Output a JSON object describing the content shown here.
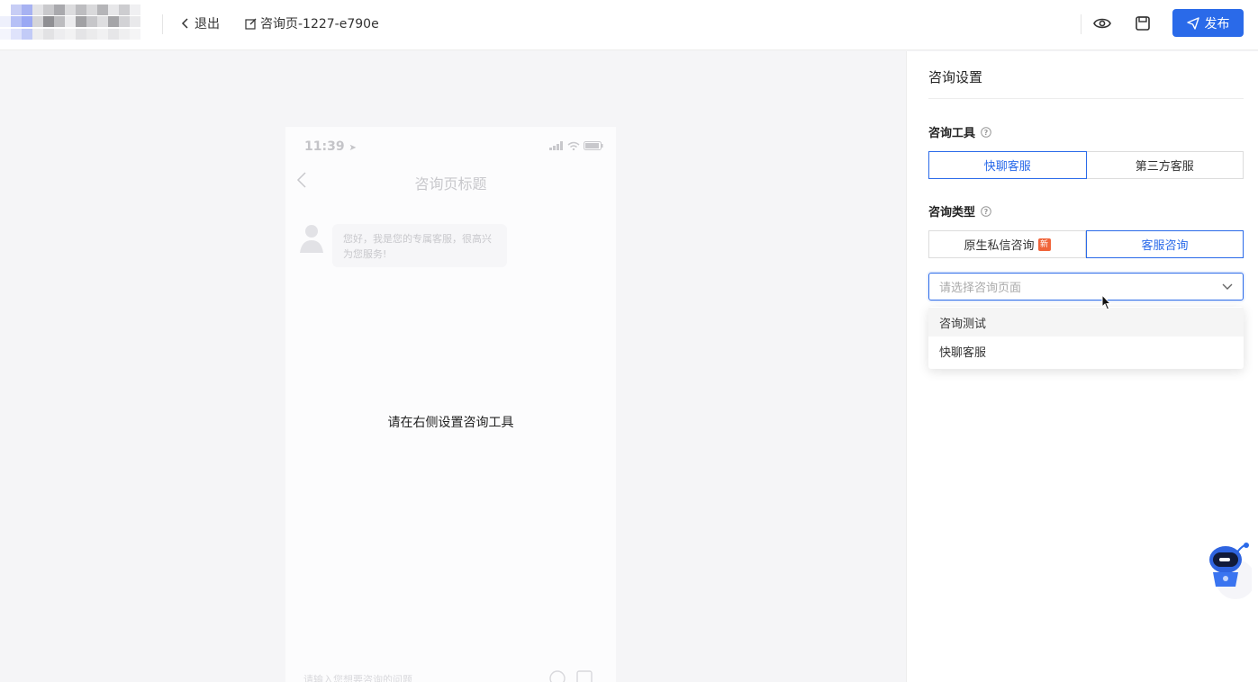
{
  "header": {
    "exit_label": "退出",
    "page_name": "咨询页-1227-e790e",
    "publish_label": "发布"
  },
  "phone": {
    "time": "11:39",
    "title": "咨询页标题",
    "greeting": "您好，我是您的专属客服，很高兴为您服务!",
    "hint": "请在右侧设置咨询工具",
    "input_placeholder": "请输入您想要咨询的问题"
  },
  "panel": {
    "title": "咨询设置",
    "tool_section": {
      "label": "咨询工具",
      "options": [
        "快聊客服",
        "第三方客服"
      ],
      "selected": 0
    },
    "type_section": {
      "label": "咨询类型",
      "options": [
        "原生私信咨询",
        "客服咨询"
      ],
      "new_badge": "新",
      "selected": 1
    },
    "select": {
      "placeholder": "请选择咨询页面",
      "options": [
        "咨询测试",
        "快聊客服"
      ]
    }
  },
  "colors": {
    "primary": "#2a6ae9",
    "badge": "#f0643a"
  }
}
